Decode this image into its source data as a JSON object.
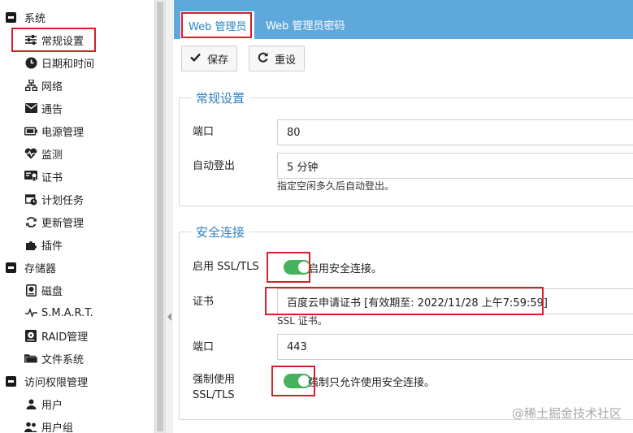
{
  "sidebar": {
    "groups": [
      {
        "label": "系统",
        "items": [
          {
            "label": "常规设置",
            "icon": "sliders-icon"
          },
          {
            "label": "日期和时间",
            "icon": "clock-icon"
          },
          {
            "label": "网络",
            "icon": "network-icon"
          },
          {
            "label": "通告",
            "icon": "envelope-icon"
          },
          {
            "label": "电源管理",
            "icon": "battery-icon"
          },
          {
            "label": "监测",
            "icon": "heartbeat-icon"
          },
          {
            "label": "证书",
            "icon": "certificate-icon"
          },
          {
            "label": "计划任务",
            "icon": "calendar-clock-icon"
          },
          {
            "label": "更新管理",
            "icon": "refresh-icon"
          },
          {
            "label": "插件",
            "icon": "puzzle-icon"
          }
        ]
      },
      {
        "label": "存储器",
        "items": [
          {
            "label": "磁盘",
            "icon": "disk-icon"
          },
          {
            "label": "S.M.A.R.T.",
            "icon": "pulse-icon"
          },
          {
            "label": "RAID管理",
            "icon": "raid-icon"
          },
          {
            "label": "文件系统",
            "icon": "folder-icon"
          }
        ]
      },
      {
        "label": "访问权限管理",
        "items": [
          {
            "label": "用户",
            "icon": "user-icon"
          },
          {
            "label": "用户组",
            "icon": "users-icon"
          }
        ]
      }
    ]
  },
  "tabs": [
    {
      "label": "Web 管理员",
      "active": true
    },
    {
      "label": "Web 管理员密码",
      "active": false
    }
  ],
  "toolbar": {
    "save_label": "保存",
    "reset_label": "重设"
  },
  "general": {
    "legend": "常规设置",
    "port_label": "端口",
    "port_value": "80",
    "autologout_label": "自动登出",
    "autologout_value": "5 分钟",
    "autologout_hint": "指定空闲多久后自动登出。"
  },
  "security": {
    "legend": "安全连接",
    "ssl_label": "启用 SSL/TLS",
    "ssl_toggle_text": "启用安全连接。",
    "ssl_enabled": true,
    "cert_label": "证书",
    "cert_value": "百度云申请证书 [有效期至: 2022/11/28 上午7:59:59]",
    "cert_hint": "SSL 证书。",
    "port_label": "端口",
    "port_value": "443",
    "force_label_line1": "强制使用",
    "force_label_line2": "SSL/TLS",
    "force_toggle_text": "强制只允许使用安全连接。",
    "force_enabled": true
  },
  "watermark": "@稀土掘金技术社区",
  "colors": {
    "accent": "#5fa8dc",
    "legend": "#2f82bf",
    "toggle_on": "#46b35c",
    "highlight_box": "#d4202a"
  }
}
